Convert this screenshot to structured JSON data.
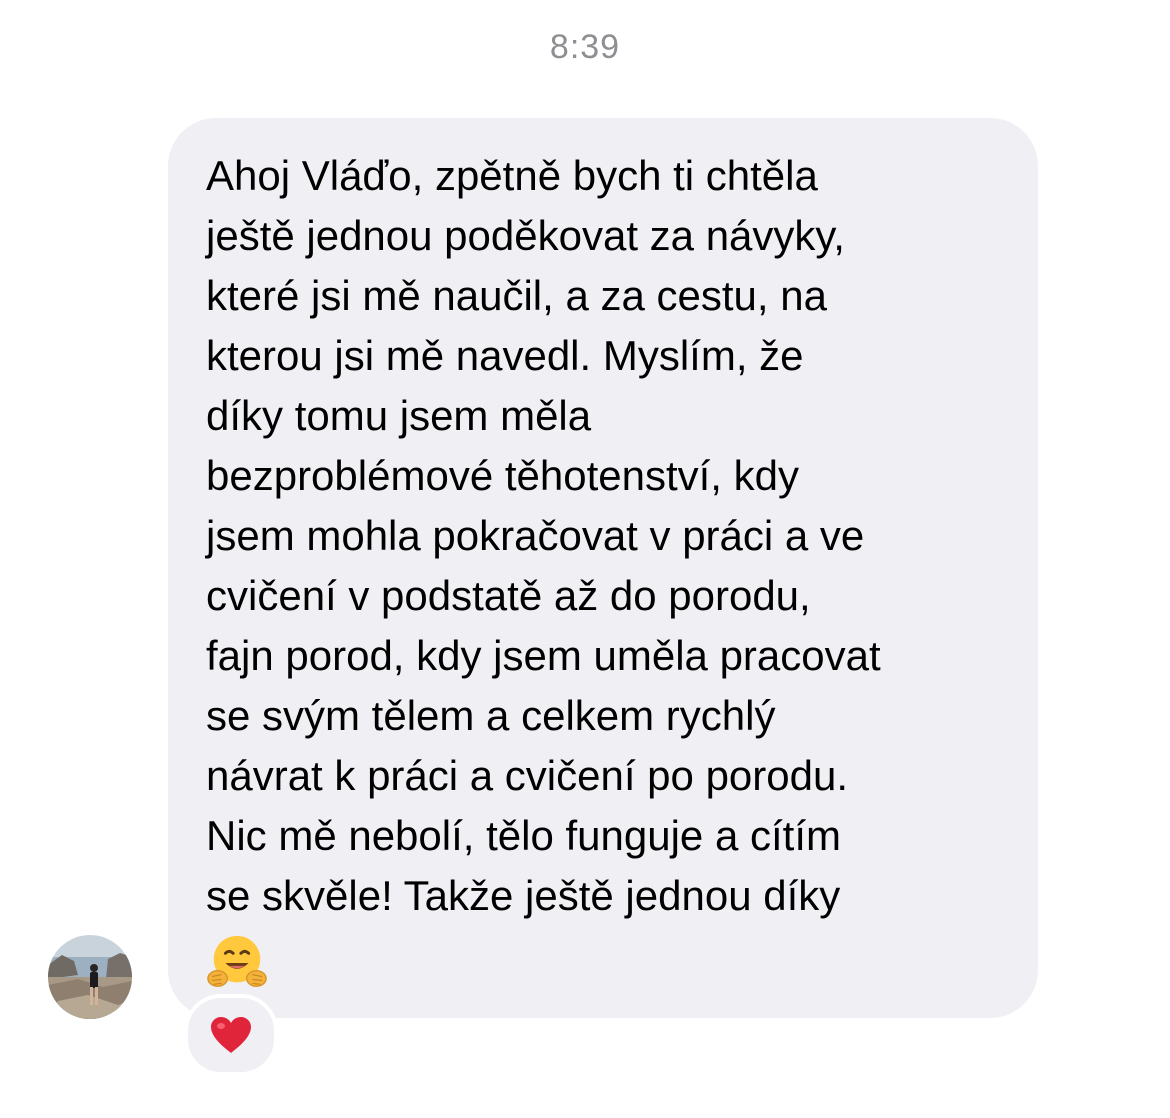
{
  "conversation": {
    "timestamp": "8:39",
    "message": {
      "text": "Ahoj Vláďo, zpětně bych ti chtěla\nještě jednou poděkovat za návyky,\nkteré jsi mě naučil, a za cestu, na\nkterou jsi mě navedl. Myslím, že\ndíky tomu jsem měla\nbezproblémové těhotenství, kdy\njsem mohla pokračovat v práci a ve\ncvičení v podstatě až do porodu,\nfajn porod, kdy jsem uměla pracovat\nse svým tělem a celkem rychlý\nnávrat k práci a cvičení po porodu.\nNic mě nebolí, tělo funguje a cítím\nse skvěle! Takže ještě jednou díky",
      "emoji": "hugging-face",
      "reaction": "red-heart"
    },
    "colors": {
      "bubble_background": "#efeff4",
      "timestamp_text": "#8e8e93",
      "message_text": "#000000",
      "heart": "#e0243a",
      "emoji_face": "#ffc83d"
    }
  }
}
